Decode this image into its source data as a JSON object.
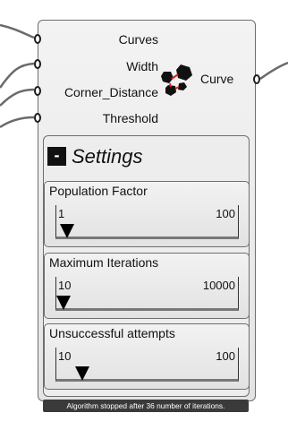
{
  "component": {
    "inputs": [
      {
        "label": "Curves"
      },
      {
        "label": "Width"
      },
      {
        "label": "Corner_Distance"
      },
      {
        "label": "Threshold"
      }
    ],
    "output": {
      "label": "Curve"
    },
    "icon": "polygon-nodes-icon"
  },
  "settings": {
    "collapse_symbol": "-",
    "title": "Settings",
    "sliders": [
      {
        "label": "Population Factor",
        "min": "1",
        "max": "100",
        "position": 0.02
      },
      {
        "label": "Maximum Iterations",
        "min": "10",
        "max": "10000",
        "position": 0.0
      },
      {
        "label": "Unsuccessful attempts",
        "min": "10",
        "max": "100",
        "position": 0.11
      }
    ]
  },
  "status": {
    "message": "Algorithm stopped after 36 number of iterations."
  },
  "colors": {
    "wire": "#6a6a6a",
    "panel": "#ececec",
    "status_bg": "#3a3a3a",
    "icon_fill": "#111111",
    "icon_link": "#e02020"
  }
}
